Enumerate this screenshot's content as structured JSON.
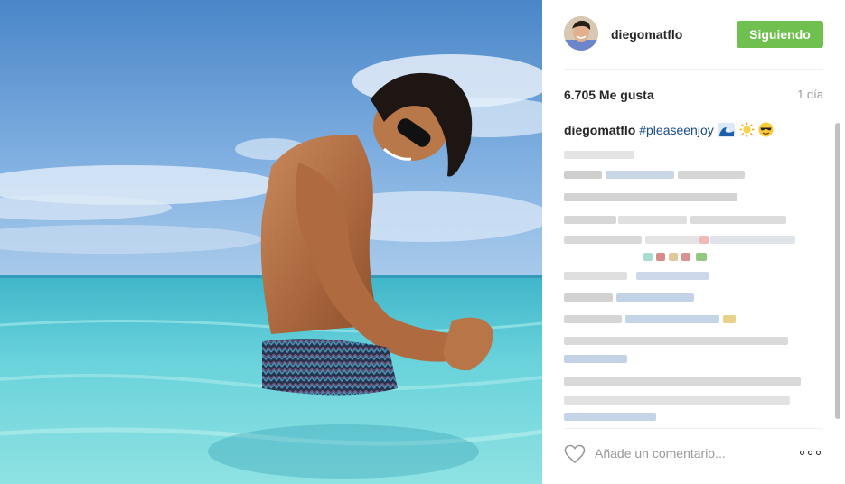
{
  "post": {
    "author": "diegomatflo",
    "follow_label": "Siguiendo",
    "likes": "6.705 Me gusta",
    "time_ago": "1 día",
    "caption_user": "diegomatflo",
    "caption_hashtag": "#pleaseenjoy",
    "caption_emojis": [
      "wave-emoji",
      "sun-emoji",
      "sunglasses-face-emoji"
    ],
    "comment_placeholder": "Añade un comentario...",
    "follow_color": "#70c050",
    "hashtag_color": "#1a4b85"
  }
}
